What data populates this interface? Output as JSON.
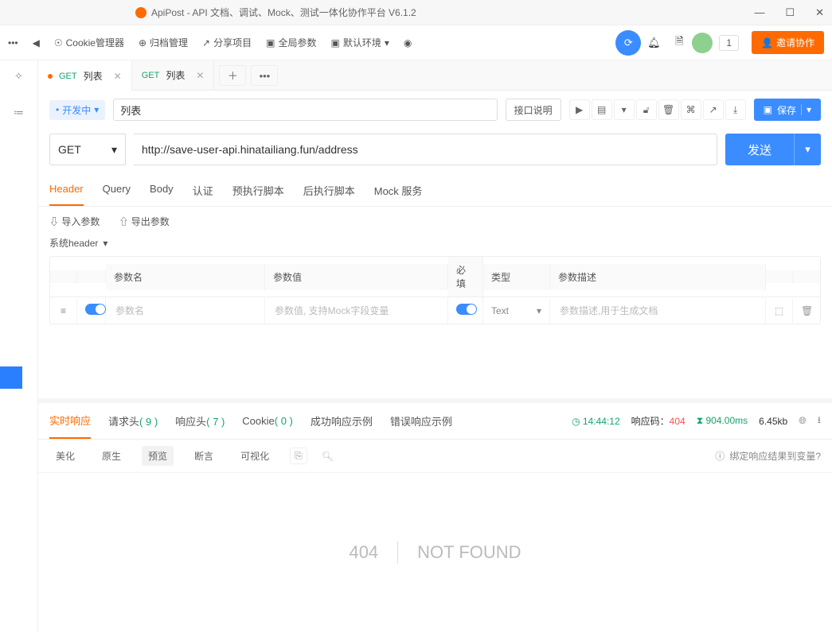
{
  "app": {
    "title": "ApiPost - API 文档、调试、Mock、测试一体化协作平台 V6.1.2"
  },
  "toolbar": {
    "cookie": "Cookie管理器",
    "archive": "归档管理",
    "share": "分享项目",
    "globals": "全局参数",
    "env": "默认环境",
    "badge": "1",
    "invite": "邀请协作"
  },
  "tabs": [
    {
      "method": "GET",
      "label": "列表",
      "dirty": true
    },
    {
      "method": "GET",
      "label": "列表",
      "dirty": false
    }
  ],
  "request": {
    "status": "开发中",
    "name": "列表",
    "desc_btn": "接口说明",
    "save": "保存",
    "method": "GET",
    "url": "http://save-user-api.hinatailiang.fun/address",
    "send": "发送"
  },
  "subtabs": {
    "header": "Header",
    "query": "Query",
    "body": "Body",
    "auth": "认证",
    "prescript": "预执行脚本",
    "postscript": "后执行脚本",
    "mock": "Mock 服务"
  },
  "param_tools": {
    "import": "导入参数",
    "export": "导出参数"
  },
  "sys_header_label": "系统header",
  "ptable": {
    "headers": {
      "name": "参数名",
      "value": "参数值",
      "required": "必填",
      "type": "类型",
      "desc": "参数描述"
    },
    "row": {
      "name_ph": "参数名",
      "value_ph": "参数值, 支持Mock字段变量",
      "type": "Text",
      "desc_ph": "参数描述,用于生成文档"
    }
  },
  "response": {
    "tabs": {
      "realtime": "实时响应",
      "reqheaders_label": "请求头",
      "reqheaders_count": "( 9 )",
      "respheaders_label": "响应头",
      "respheaders_count": "( 7 )",
      "cookie_label": "Cookie",
      "cookie_count": "( 0 )",
      "success_ex": "成功响应示例",
      "error_ex": "错误响应示例"
    },
    "meta": {
      "time": "14:44:12",
      "code_label": "响应码：",
      "code": "404",
      "duration": "904.00ms",
      "size": "6.45kb"
    },
    "viewtabs": {
      "beautify": "美化",
      "raw": "原生",
      "preview": "预览",
      "assert": "断言",
      "visual": "可视化"
    },
    "bind_hint": "绑定响应结果到变量?",
    "preview": {
      "code": "404",
      "text": "NOT FOUND"
    }
  }
}
